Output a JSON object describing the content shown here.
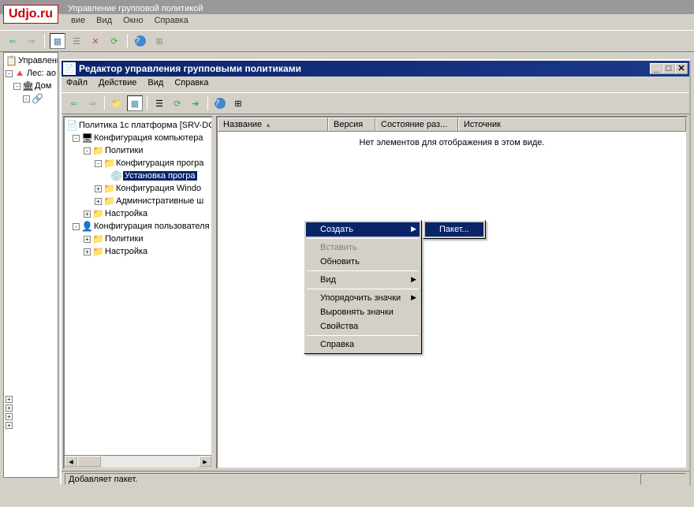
{
  "watermark": "Udjo.ru",
  "outer": {
    "title": "Управление групповой политикой",
    "menu": [
      "вие",
      "Вид",
      "Окно",
      "Справка"
    ],
    "tree": {
      "root": "Управление",
      "forest": "Лес: ao",
      "domain": "Дом"
    }
  },
  "inner": {
    "title": "Редактор управления групповыми политиками",
    "menu": [
      "Файл",
      "Действие",
      "Вид",
      "Справка"
    ],
    "tree": {
      "root": "Политика 1с платформа [SRV-DC",
      "computer_config": "Конфигурация компьютера",
      "policies": "Политики",
      "software_config": "Конфигурация програ",
      "software_install": "Установка програ",
      "windows_config": "Конфигурация Windo",
      "admin_templates": "Административные ш",
      "settings": "Настройка",
      "user_config": "Конфигурация пользователя",
      "user_policies": "Политики",
      "user_settings": "Настройка"
    },
    "list": {
      "columns": [
        "Название",
        "Версия",
        "Состояние раз...",
        "Источник"
      ],
      "empty_text": "Нет элементов для отображения в этом виде."
    },
    "status": "Добавляет пакет."
  },
  "context_menu": {
    "create": "Создать",
    "paste": "Вставить",
    "refresh": "Обновить",
    "view": "Вид",
    "arrange_icons": "Упорядочить значки",
    "align_icons": "Выровнять значки",
    "properties": "Свойства",
    "help": "Справка",
    "submenu_package": "Пакет..."
  }
}
